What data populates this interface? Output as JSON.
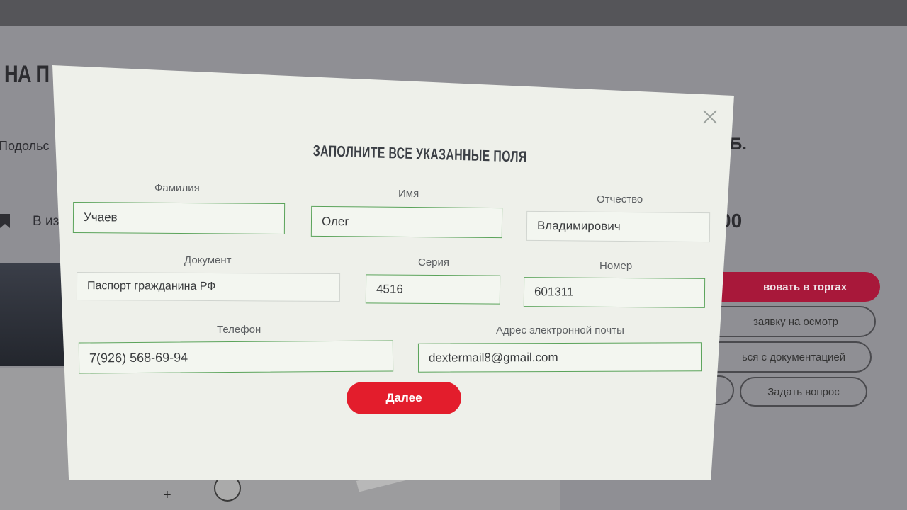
{
  "background": {
    "heading": "НА П",
    "city": "Подольс",
    "in_text": "В из",
    "right_title": "Б.",
    "right_price": "00",
    "buttons": {
      "participate": "вовать в торгах",
      "inspection": "заявку на осмотр",
      "documents": "ься с документацией",
      "ask_question": "Задать вопрос"
    }
  },
  "modal": {
    "title": "ЗАПОЛНИТЕ ВСЕ УКАЗАННЫЕ ПОЛЯ",
    "fields": {
      "surname": {
        "label": "Фамилия",
        "value": "Учаев"
      },
      "name": {
        "label": "Имя",
        "value": "Олег"
      },
      "patronymic": {
        "label": "Отчество",
        "value": "Владимирович"
      },
      "document": {
        "label": "Документ",
        "value": "Паспорт гражданина РФ"
      },
      "series": {
        "label": "Серия",
        "value": "4516"
      },
      "number": {
        "label": "Номер",
        "value": "601311"
      },
      "phone": {
        "label": "Телефон",
        "value": "7(926) 568-69-94"
      },
      "email": {
        "label": "Адрес электронной почты",
        "value": "dextermail8@gmail.com"
      }
    },
    "next_label": "Далее"
  },
  "colors": {
    "accent_red": "#e31d2c",
    "field_border_green": "#5aa35a",
    "modal_bg": "#eef0ea"
  }
}
